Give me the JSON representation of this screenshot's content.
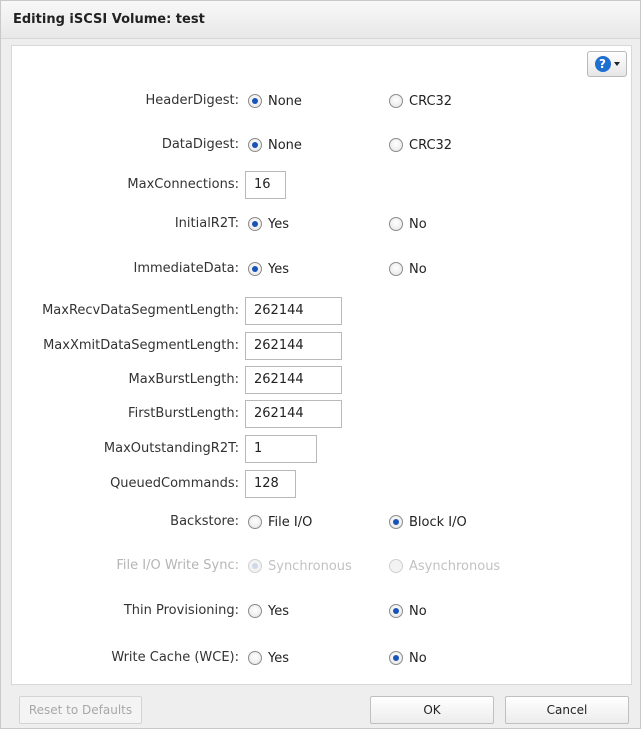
{
  "dialog": {
    "title": "Editing iSCSI Volume: test",
    "help_icon": "question-circle-icon"
  },
  "fields": {
    "header_digest": {
      "label": "HeaderDigest:",
      "options": [
        "None",
        "CRC32"
      ],
      "selected": "None"
    },
    "data_digest": {
      "label": "DataDigest:",
      "options": [
        "None",
        "CRC32"
      ],
      "selected": "None"
    },
    "max_connections": {
      "label": "MaxConnections:",
      "value": "16"
    },
    "initial_r2t": {
      "label": "InitialR2T:",
      "options": [
        "Yes",
        "No"
      ],
      "selected": "Yes"
    },
    "immediate_data": {
      "label": "ImmediateData:",
      "options": [
        "Yes",
        "No"
      ],
      "selected": "Yes"
    },
    "max_recv_data_segment_length": {
      "label": "MaxRecvDataSegmentLength:",
      "value": "262144"
    },
    "max_xmit_data_segment_length": {
      "label": "MaxXmitDataSegmentLength:",
      "value": "262144"
    },
    "max_burst_length": {
      "label": "MaxBurstLength:",
      "value": "262144"
    },
    "first_burst_length": {
      "label": "FirstBurstLength:",
      "value": "262144"
    },
    "max_outstanding_r2t": {
      "label": "MaxOutstandingR2T:",
      "value": "1"
    },
    "queued_commands": {
      "label": "QueuedCommands:",
      "value": "128"
    },
    "backstore": {
      "label": "Backstore:",
      "options": [
        "File I/O",
        "Block I/O"
      ],
      "selected": "Block I/O"
    },
    "file_io_write_sync": {
      "label": "File I/O Write Sync:",
      "options": [
        "Synchronous",
        "Asynchronous"
      ],
      "selected": "Synchronous",
      "disabled": true
    },
    "thin_provisioning": {
      "label": "Thin Provisioning:",
      "options": [
        "Yes",
        "No"
      ],
      "selected": "No"
    },
    "write_cache": {
      "label": "Write Cache (WCE):",
      "options": [
        "Yes",
        "No"
      ],
      "selected": "No"
    }
  },
  "footer": {
    "reset_label": "Reset to Defaults",
    "ok_label": "OK",
    "cancel_label": "Cancel"
  },
  "colors": {
    "accent": "#1a53b8",
    "help_blue": "#1e6fd0"
  }
}
